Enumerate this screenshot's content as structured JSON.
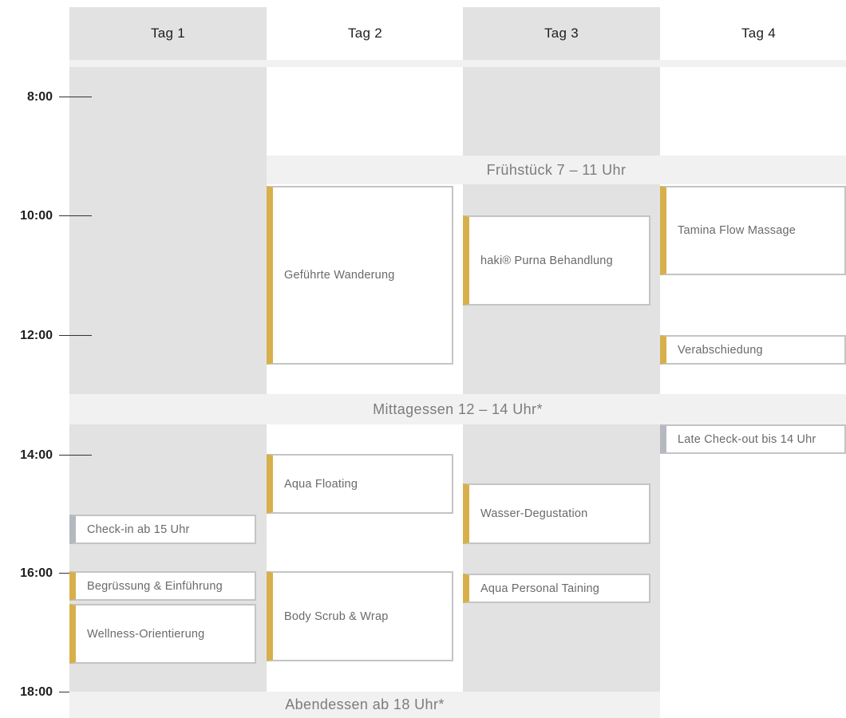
{
  "days": [
    "Tag 1",
    "Tag 2",
    "Tag 3",
    "Tag 4"
  ],
  "times": [
    "8:00",
    "10:00",
    "12:00",
    "14:00",
    "16:00",
    "18:00"
  ],
  "bands": {
    "breakfast": "Frühstück 7 – 11 Uhr",
    "lunch": "Mittagessen 12 – 14 Uhr*",
    "dinner": "Abendessen ab 18 Uhr*"
  },
  "events": {
    "day1": [
      "Check-in ab 15 Uhr",
      "Begrüssung & Einführung",
      "Wellness-Orientierung"
    ],
    "day2": [
      "Geführte Wanderung",
      "Aqua Floating",
      "Body Scrub & Wrap"
    ],
    "day3": [
      "haki® Purna Behandlung",
      "Wasser-Degustation",
      "Aqua Personal Taining"
    ],
    "day4": [
      "Tamina Flow Massage",
      "Verabschiedung",
      "Late Check-out bis 14 Uhr"
    ]
  },
  "colors": {
    "column_shade": "#e2e2e2",
    "band": "#f1f1f1",
    "accent_gold": "#d7b04b",
    "accent_grey": "#b5b8bf"
  }
}
